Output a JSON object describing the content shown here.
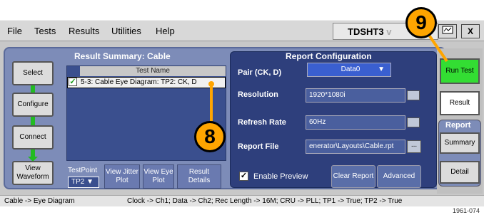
{
  "menu": [
    "File",
    "Tests",
    "Results",
    "Utilities",
    "Help"
  ],
  "app_name": "TDSHT3",
  "app_name_tail": "v",
  "window_buttons": {
    "close": "X"
  },
  "result_summary": {
    "title": "Result Summary: Cable",
    "column_header": "Test Name",
    "rows": [
      "5-3: Cable Eye Diagram: TP2: CK, D"
    ]
  },
  "steps": [
    "Select",
    "Configure",
    "Connect",
    "View Waveform"
  ],
  "testpoint": {
    "label": "TestPoint",
    "value": "TP2"
  },
  "bottom_buttons": [
    "View Jitter Plot",
    "View Eye Plot",
    "Result Details"
  ],
  "report_config": {
    "title": "Report Configuration",
    "fields": [
      {
        "label": "Pair (CK, D)",
        "value": "Data0"
      },
      {
        "label": "Resolution",
        "value": "1920*1080i"
      },
      {
        "label": "Refresh Rate",
        "value": "60Hz"
      },
      {
        "label": "Report File",
        "value": "enerator\\Layouts\\Cable.rpt"
      }
    ],
    "browse_label": "...",
    "enable_preview": "Enable Preview",
    "clear_report": "Clear Report",
    "advanced": "Advanced"
  },
  "right_panel": {
    "run_test": "Run Test",
    "result": "Result",
    "report_group": "Report",
    "summary": "Summary",
    "detail": "Detail"
  },
  "status_bar": {
    "left": "Cable -> Eye Diagram",
    "right": "Clock -> Ch1; Data -> Ch2; Rec Length -> 16M; CRU -> PLL; TP1 -> True; TP2 -> True"
  },
  "callouts": [
    "9",
    "8"
  ],
  "figure_ref": "1961-074",
  "colors": {
    "run_test": "#33dd33",
    "callout": "#ffa500",
    "panel": "#7d8cb8",
    "report_bg": "#2e3f7c"
  }
}
